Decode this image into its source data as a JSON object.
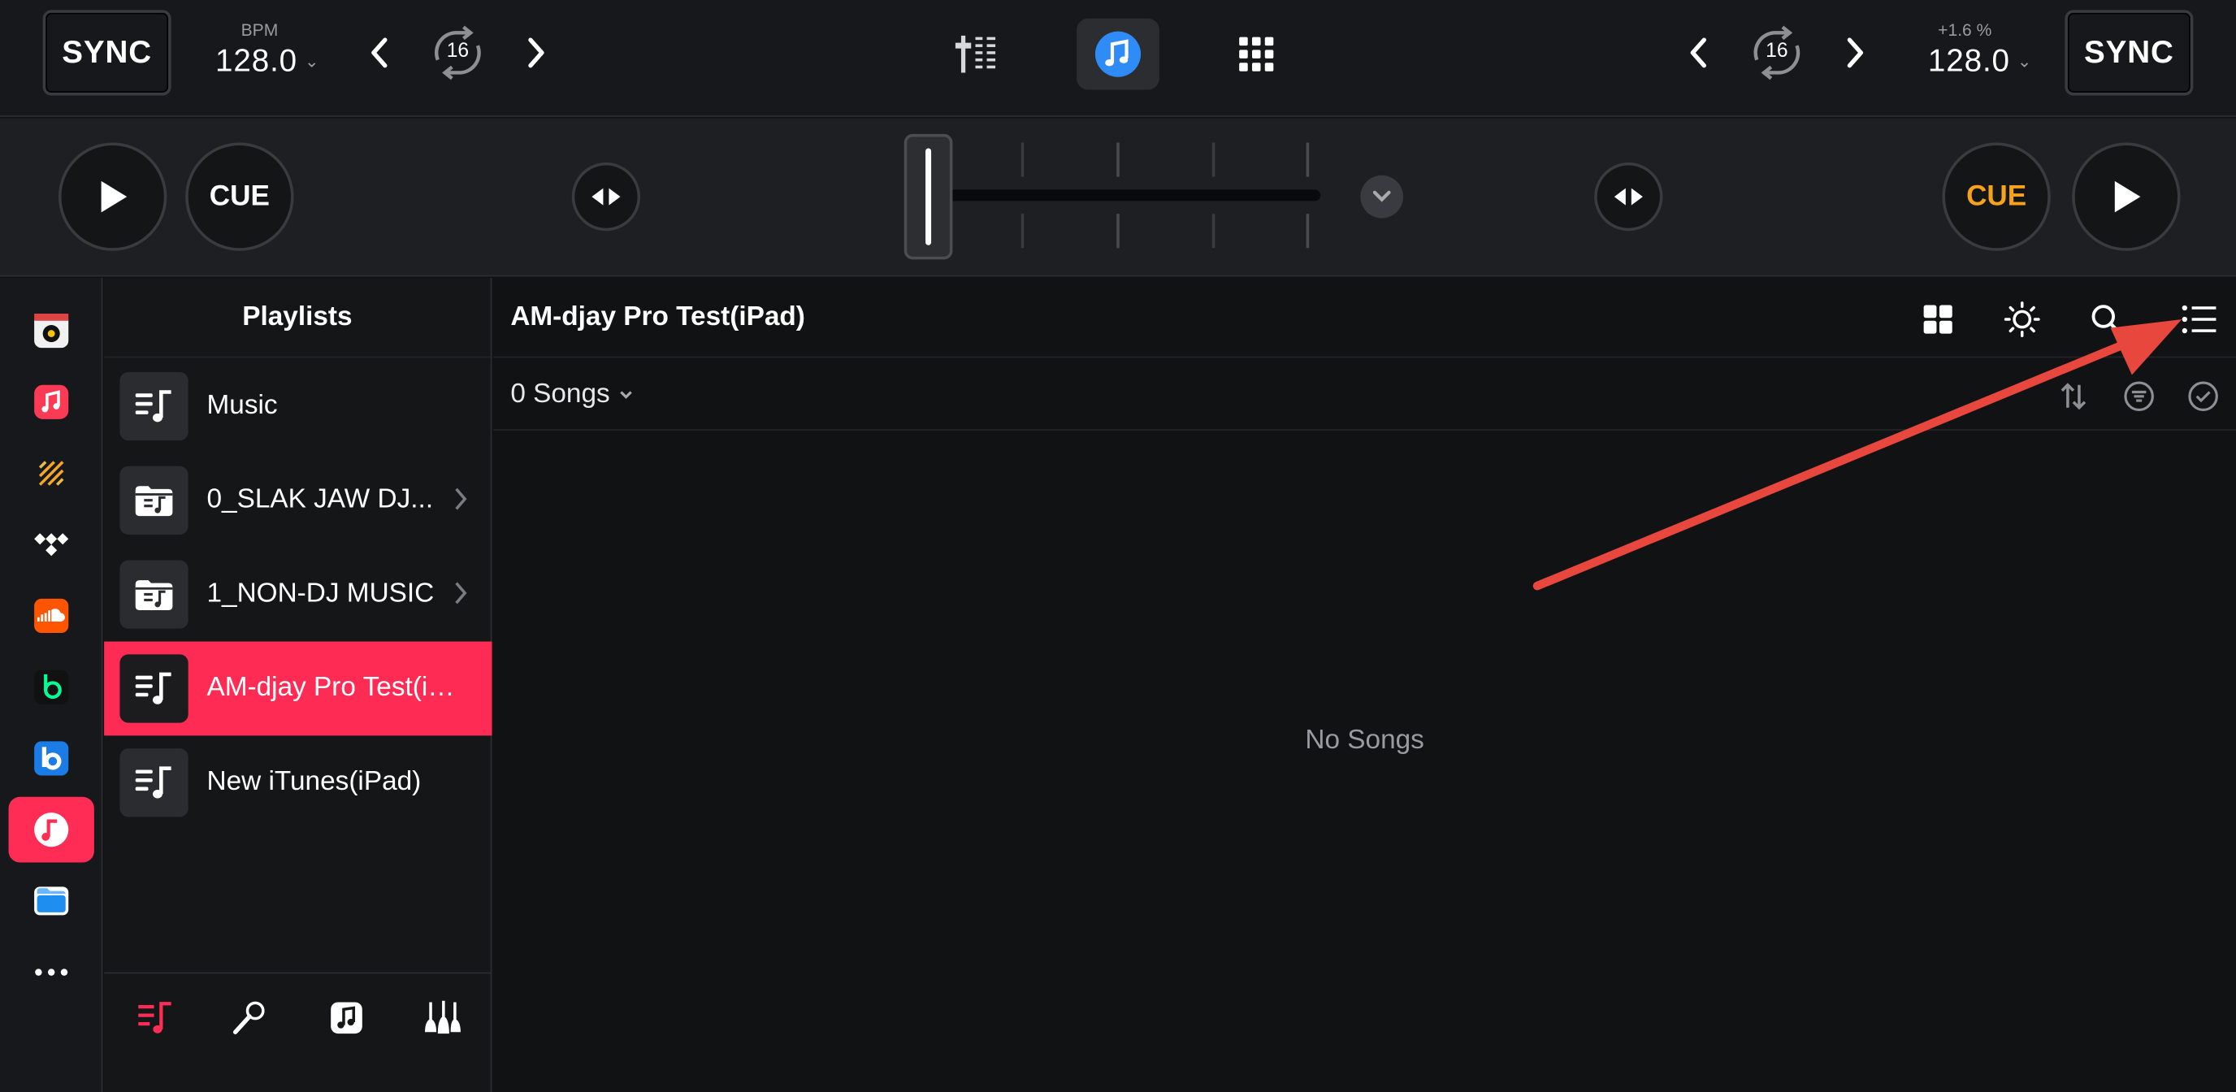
{
  "deck_left": {
    "sync_label": "SYNC",
    "bpm_label": "BPM",
    "bpm_value": "128.0",
    "loop_size": "16",
    "cue_label": "CUE"
  },
  "deck_right": {
    "sync_label": "SYNC",
    "pitch_label": "+1.6 %",
    "bpm_value": "128.0",
    "loop_size": "16",
    "cue_label": "CUE"
  },
  "center_icons": [
    "mixer-icon",
    "music-library-icon",
    "pads-grid-icon"
  ],
  "rail": {
    "items": [
      {
        "name": "beatport-icon",
        "active": false
      },
      {
        "name": "apple-music-icon",
        "active": false
      },
      {
        "name": "beatsource-icon",
        "active": false
      },
      {
        "name": "tidal-icon",
        "active": false
      },
      {
        "name": "soundcloud-icon",
        "active": false
      },
      {
        "name": "beatport-streaming-icon",
        "active": false
      },
      {
        "name": "beatsource-streaming-icon",
        "active": false
      },
      {
        "name": "music-library-icon",
        "active": true
      },
      {
        "name": "files-icon",
        "active": false
      },
      {
        "name": "more-icon",
        "active": false
      }
    ]
  },
  "playlists": {
    "header": "Playlists",
    "items": [
      {
        "label": "Music",
        "icon": "playlist-icon",
        "has_children": false,
        "active": false
      },
      {
        "label": "0_SLAK JAW DJ...",
        "icon": "folder-icon",
        "has_children": true,
        "active": false
      },
      {
        "label": "1_NON-DJ MUSIC",
        "icon": "folder-icon",
        "has_children": true,
        "active": false
      },
      {
        "label": "AM-djay Pro Test(iP...",
        "icon": "playlist-icon",
        "has_children": false,
        "active": true
      },
      {
        "label": "New iTunes(iPad)",
        "icon": "playlist-icon",
        "has_children": false,
        "active": false
      }
    ],
    "footer_icons": [
      "playlists-tab-icon",
      "artists-tab-icon",
      "albums-tab-icon",
      "genres-tab-icon"
    ]
  },
  "main": {
    "title": "AM-djay Pro Test(iPad)",
    "song_count": "0 Songs",
    "empty_text": "No Songs",
    "header_icons": [
      "grid-view-icon",
      "brightness-icon",
      "search-icon",
      "list-view-icon"
    ],
    "sub_icons": [
      "sort-icon",
      "filter-icon",
      "select-icon"
    ]
  },
  "colors": {
    "accent": "#FE2C55",
    "cue_active": "#F7A21B",
    "music_blue": "#2F8BF5",
    "arrow": "#E8473D"
  }
}
